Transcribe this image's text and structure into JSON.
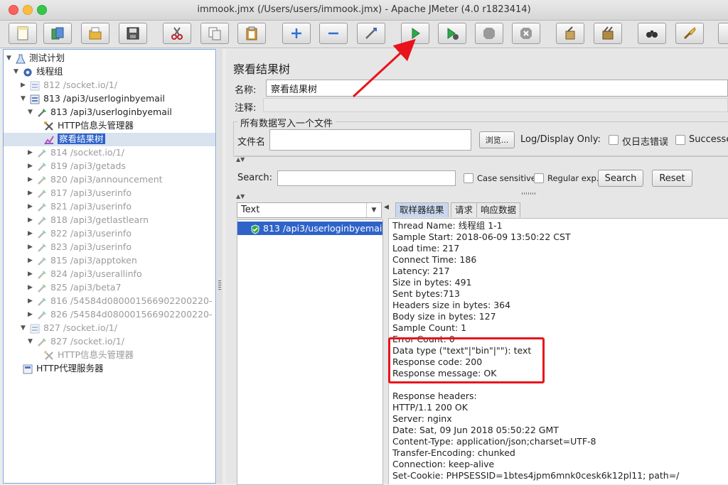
{
  "window": {
    "title": "immook.jmx (/Users/users/immook.jmx) - Apache JMeter (4.0 r1823414)"
  },
  "toolbar": {
    "buttons": [
      {
        "name": "new-icon"
      },
      {
        "name": "templates-icon"
      },
      {
        "name": "open-icon"
      },
      {
        "name": "save-icon"
      },
      {
        "name": "cut-icon"
      },
      {
        "name": "copy-icon"
      },
      {
        "name": "paste-icon"
      },
      {
        "name": "expand-icon"
      },
      {
        "name": "collapse-icon"
      },
      {
        "name": "toggle-icon"
      },
      {
        "name": "start-icon"
      },
      {
        "name": "start-no-timers-icon"
      },
      {
        "name": "stop-icon"
      },
      {
        "name": "shutdown-icon"
      },
      {
        "name": "clear-icon"
      },
      {
        "name": "clear-all-icon"
      },
      {
        "name": "search-icon"
      },
      {
        "name": "reset-search-icon"
      }
    ]
  },
  "tree": {
    "nodes": [
      {
        "label": "测试计划",
        "indent": 0,
        "arrow": "▼",
        "icon": "flask",
        "state": "normal"
      },
      {
        "label": "线程组",
        "indent": 1,
        "arrow": "▼",
        "icon": "gear",
        "state": "normal"
      },
      {
        "label": "812 /socket.io/1/",
        "indent": 2,
        "arrow": "▶",
        "icon": "controller",
        "state": "disabled"
      },
      {
        "label": "813 /api3/userloginbyemail",
        "indent": 2,
        "arrow": "▼",
        "icon": "controller",
        "state": "normal"
      },
      {
        "label": "813 /api3/userloginbyemail",
        "indent": 3,
        "arrow": "▼",
        "icon": "pipette",
        "state": "normal"
      },
      {
        "label": "HTTP信息头管理器",
        "indent": 4,
        "arrow": "",
        "icon": "tools",
        "state": "normal"
      },
      {
        "label": "察看结果树",
        "indent": 4,
        "arrow": "",
        "icon": "chart",
        "state": "selected"
      },
      {
        "label": "814 /socket.io/1/",
        "indent": 3,
        "arrow": "▶",
        "icon": "pipette",
        "state": "disabled"
      },
      {
        "label": "819 /api3/getads",
        "indent": 3,
        "arrow": "▶",
        "icon": "pipette",
        "state": "disabled"
      },
      {
        "label": "820 /api3/announcement",
        "indent": 3,
        "arrow": "▶",
        "icon": "pipette",
        "state": "disabled"
      },
      {
        "label": "817 /api3/userinfo",
        "indent": 3,
        "arrow": "▶",
        "icon": "pipette",
        "state": "disabled"
      },
      {
        "label": "821 /api3/userinfo",
        "indent": 3,
        "arrow": "▶",
        "icon": "pipette",
        "state": "disabled"
      },
      {
        "label": "818 /api3/getlastlearn",
        "indent": 3,
        "arrow": "▶",
        "icon": "pipette",
        "state": "disabled"
      },
      {
        "label": "822 /api3/userinfo",
        "indent": 3,
        "arrow": "▶",
        "icon": "pipette",
        "state": "disabled"
      },
      {
        "label": "823 /api3/userinfo",
        "indent": 3,
        "arrow": "▶",
        "icon": "pipette",
        "state": "disabled"
      },
      {
        "label": "815 /api3/apptoken",
        "indent": 3,
        "arrow": "▶",
        "icon": "pipette",
        "state": "disabled"
      },
      {
        "label": "824 /api3/userallinfo",
        "indent": 3,
        "arrow": "▶",
        "icon": "pipette",
        "state": "disabled"
      },
      {
        "label": "825 /api3/beta7",
        "indent": 3,
        "arrow": "▶",
        "icon": "pipette",
        "state": "disabled"
      },
      {
        "label": "816 /54584d080001566902200220-",
        "indent": 3,
        "arrow": "▶",
        "icon": "pipette",
        "state": "disabled"
      },
      {
        "label": "826 /54584d080001566902200220-",
        "indent": 3,
        "arrow": "▶",
        "icon": "pipette",
        "state": "disabled"
      },
      {
        "label": "827 /socket.io/1/",
        "indent": 2,
        "arrow": "▼",
        "icon": "controller",
        "state": "disabled"
      },
      {
        "label": "827 /socket.io/1/",
        "indent": 3,
        "arrow": "▼",
        "icon": "pipette",
        "state": "disabled"
      },
      {
        "label": "HTTP信息头管理器",
        "indent": 4,
        "arrow": "",
        "icon": "tools",
        "state": "disabled"
      },
      {
        "label": "HTTP代理服务器",
        "indent": 1,
        "arrow": "",
        "icon": "proxy",
        "state": "normal"
      }
    ]
  },
  "panel": {
    "title": "察看结果树",
    "name_label": "名称:",
    "name_value": "察看结果树",
    "comment_label": "注释:",
    "group_title": "所有数据写入一个文件",
    "filename_label": "文件名",
    "browse_label": "浏览...",
    "log_display_label": "Log/Display Only:",
    "errors_only_label": "仅日志错误",
    "successes_label": "Successes",
    "search_label": "Search:",
    "case_sensitive_label": "Case sensitive",
    "regular_exp_label": "Regular exp.",
    "search_button": "Search",
    "reset_button": "Reset"
  },
  "results": {
    "renderer": "Text",
    "items": [
      {
        "label": "813 /api3/userloginbyemail",
        "status": "success"
      }
    ],
    "tabs": [
      "取样器结果",
      "请求",
      "响应数据"
    ],
    "lines": [
      "Thread Name: 线程组 1-1",
      "Sample Start: 2018-06-09 13:50:22 CST",
      "Load time: 217",
      "Connect Time: 186",
      "Latency: 217",
      "Size in bytes: 491",
      "Sent bytes:713",
      "Headers size in bytes: 364",
      "Body size in bytes: 127",
      "Sample Count: 1",
      "Error Count: 0",
      "Data type (\"text\"|\"bin\"|\"\"): text",
      "Response code: 200",
      "Response message: OK",
      "",
      "Response headers:",
      "HTTP/1.1 200 OK",
      "Server: nginx",
      "Date: Sat, 09 Jun 2018 05:50:22 GMT",
      "Content-Type: application/json;charset=UTF-8",
      "Transfer-Encoding: chunked",
      "Connection: keep-alive",
      "Set-Cookie: PHPSESSID=1btes4jpm6mnk0cesk6k12pl11; path=/"
    ]
  },
  "colors": {
    "selection": "#2f63c9",
    "annotation": "#e8131b"
  }
}
